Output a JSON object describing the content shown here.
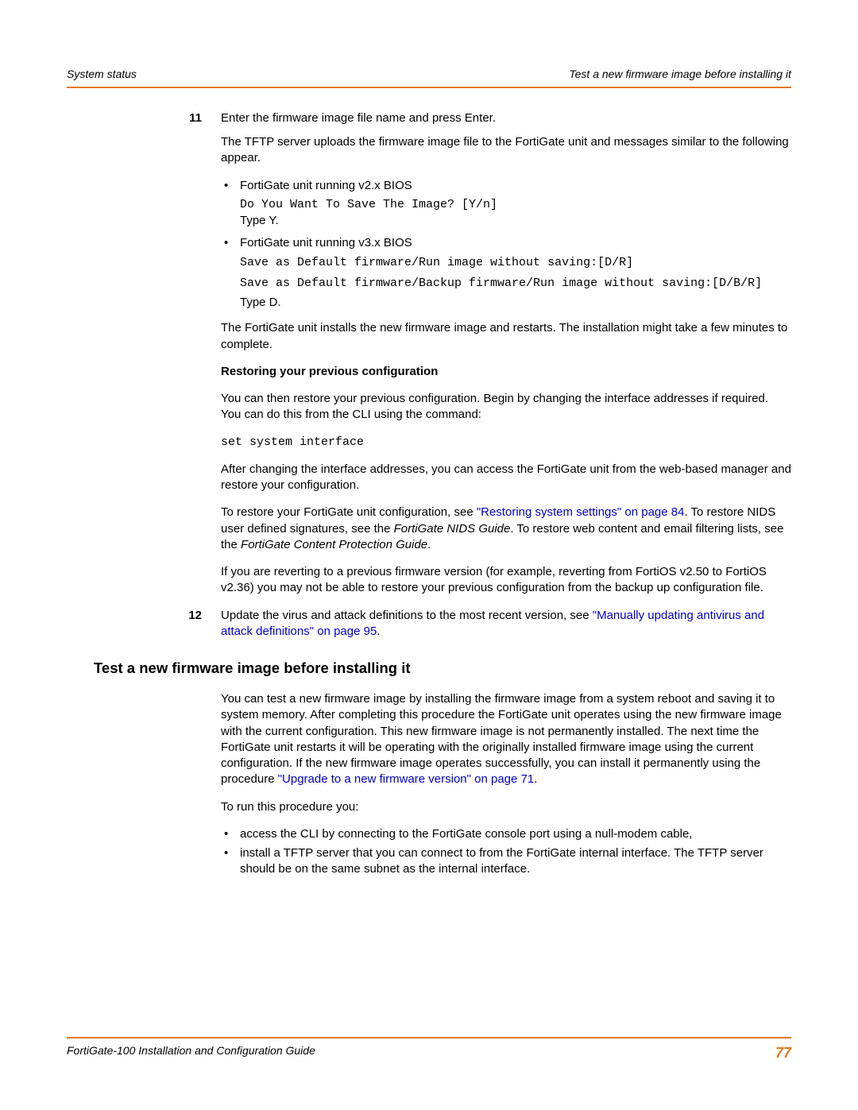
{
  "header": {
    "left": "System status",
    "right": "Test a new firmware image before installing it"
  },
  "steps": {
    "s11": {
      "num": "11",
      "intro": "Enter the firmware image file name and press Enter.",
      "p1": "The TFTP server uploads the firmware image file to the FortiGate unit and messages similar to the following appear.",
      "bullet1": "FortiGate unit running v2.x BIOS",
      "b1_line1": "Do You Want To Save The Image? [Y/n]",
      "b1_line2": "Type Y.",
      "bullet2": "FortiGate unit running v3.x BIOS",
      "b2_line1": "Save as Default firmware/Run image without saving:[D/R]",
      "b2_line2": "Save as Default firmware/Backup firmware/Run image without saving:[D/B/R]",
      "b2_line3": "Type D.",
      "p2": "The FortiGate unit installs the new firmware image and restarts. The installation might take a few minutes to complete.",
      "subhead": "Restoring your previous configuration",
      "p3": "You can then restore your previous configuration. Begin by changing the interface addresses if required. You can do this from the CLI using the command:",
      "cmd": "set system interface",
      "p4": "After changing the interface addresses, you can access the FortiGate unit from the web-based manager and restore your configuration.",
      "restore_pre": "To restore your FortiGate unit configuration, see ",
      "restore_link": "\"Restoring system settings\" on page 84",
      "restore_mid1": ". To restore NIDS user defined signatures, see the ",
      "restore_guide1": "FortiGate NIDS Guide",
      "restore_mid2": ". To restore web content and email filtering lists, see the ",
      "restore_guide2": "FortiGate Content Protection Guide",
      "restore_end": ".",
      "p6": "If you are reverting to a previous firmware version (for example, reverting from FortiOS v2.50 to FortiOS v2.36) you may not be able to restore your previous configuration from the backup up configuration file."
    },
    "s12": {
      "num": "12",
      "pre": "Update the virus and attack definitions to the most recent version, see ",
      "link": "\"Manually updating antivirus and attack definitions\" on page 95",
      "post": "."
    }
  },
  "section": {
    "title": "Test a new firmware image before installing it",
    "p1_pre": "You can test a new firmware image by installing the firmware image from a system reboot and saving it to system memory. After completing this procedure the FortiGate unit operates using the new firmware image with the current configuration. This new firmware image is not permanently installed. The next time the FortiGate unit restarts it will be operating with the originally installed firmware image using the current configuration. If the new firmware image operates successfully, you can install it permanently using the procedure ",
    "p1_link": "\"Upgrade to a new firmware version\" on page 71",
    "p1_post": ".",
    "p2": "To run this procedure you:",
    "b1": "access the CLI by connecting to the FortiGate console port using a null-modem cable,",
    "b2": "install a TFTP server that you can connect to from the FortiGate internal interface. The TFTP server should be on the same subnet as the internal interface."
  },
  "footer": {
    "left": "FortiGate-100 Installation and Configuration Guide",
    "page": "77"
  }
}
